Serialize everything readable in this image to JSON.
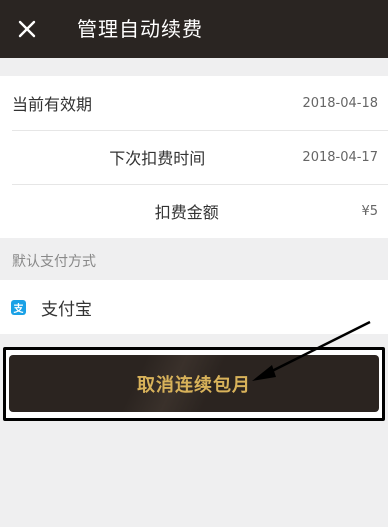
{
  "header": {
    "title": "管理自动续费",
    "close_icon": "close-icon"
  },
  "info": {
    "rows": [
      {
        "label": "当前有效期",
        "value": "2018-04-18"
      },
      {
        "label": "下次扣费时间",
        "value": "2018-04-17"
      },
      {
        "label": "扣费金额",
        "value": "¥5"
      }
    ]
  },
  "payment": {
    "section_label": "默认支付方式",
    "method_label": "支付宝",
    "method_icon": "alipay-icon"
  },
  "cancel": {
    "label": "取消连续包月"
  },
  "colors": {
    "header_bg": "#2a2522",
    "button_bg": "#2b2420",
    "button_text": "#d8b25a",
    "alipay_blue": "#1aa1e6"
  }
}
